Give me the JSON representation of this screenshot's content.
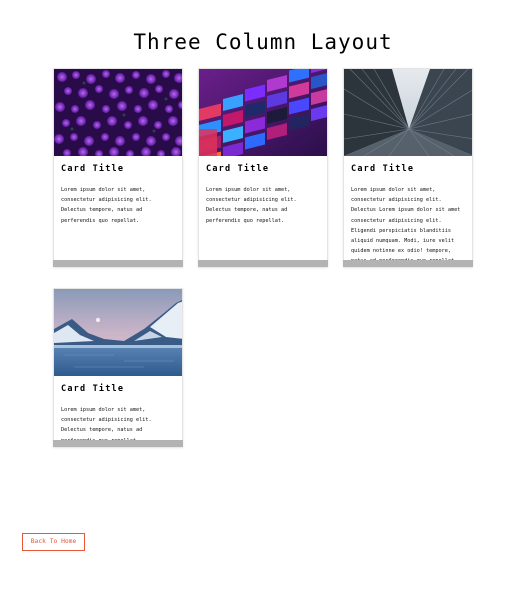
{
  "page": {
    "title": "Three Column Layout"
  },
  "cards": [
    {
      "title": "Card Title",
      "text": "Lorem ipsum dolor sit amet, consectetur adipisicing elit. Delectus tempore, natus ad perferendis quo repellat.",
      "image": "purple-flowers"
    },
    {
      "title": "Card Title",
      "text": "Lorem ipsum dolor sit amet, consectetur adipisicing elit. Delectus tempore, natus ad perferendis quo repellat.",
      "image": "colorful-building-facade"
    },
    {
      "title": "Card Title",
      "text": "Lorem ipsum dolor sit amet, consectetur adipisicing elit. Delectus Lorem ipsum dolor sit amet consectetur adipisicing elit. Eligendi perspiciatis blanditiis aliquid numquam. Modi, iure velit quidem notinne ex odio! tempore, natus ad perferendis quo repellat.",
      "image": "skyscrapers-looking-up"
    },
    {
      "title": "Card Title",
      "text": "Lorem ipsum dolor sit amet, consectetur adipisicing elit. Delectus tempore, natus ad perferendis quo repellat.",
      "image": "snowy-mountains-lake"
    }
  ],
  "footer": {
    "back_label": "Back To Home"
  },
  "colors": {
    "accent": "#e8573c",
    "card_footer": "#b3b3b3"
  }
}
